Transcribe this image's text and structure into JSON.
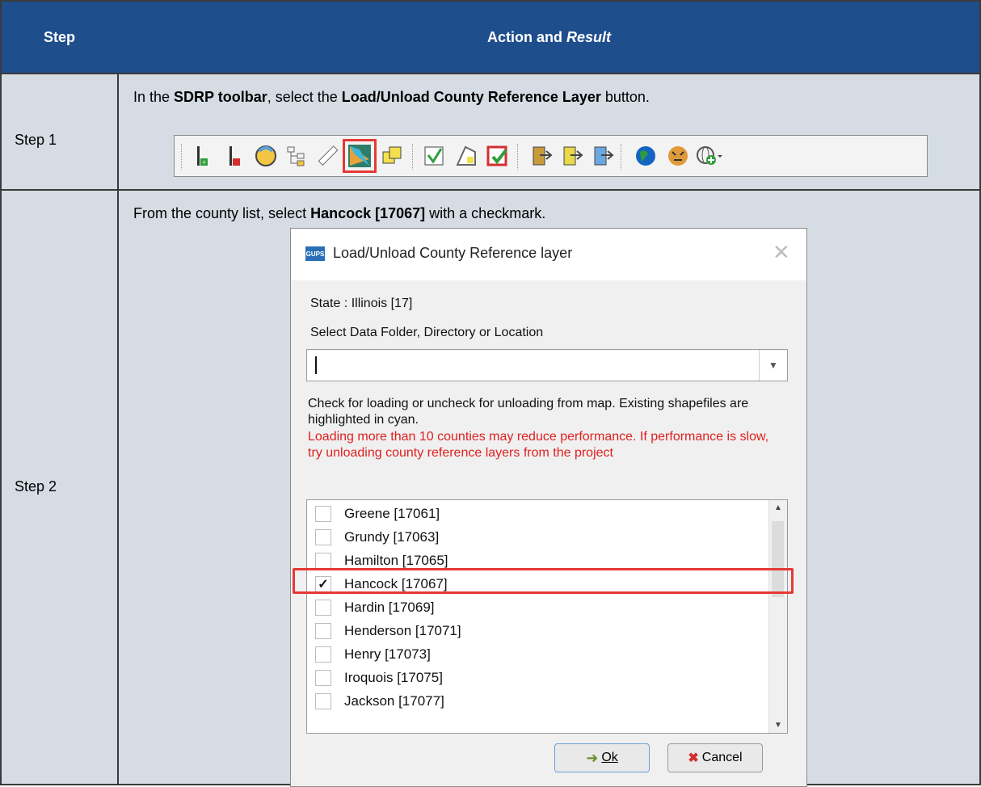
{
  "header": {
    "col_step": "Step",
    "col_action": "Action and ",
    "col_action_italic": "Result"
  },
  "step1": {
    "label": "Step 1",
    "text_a": "In the ",
    "bold_a": "SDRP toolbar",
    "text_b": ", select the ",
    "bold_b": "Load/Unload County Reference Layer",
    "text_c": " button.",
    "toolbar_icons": [
      "add-layer-icon",
      "remove-layer-icon",
      "face-icon",
      "structure-icon",
      "ruler-icon",
      "load-unload-county-icon",
      "copy-icon",
      "edit-icon",
      "shape-icon",
      "check-icon",
      "export-left-icon",
      "export-right-icon",
      "import-icon",
      "globe-icon",
      "tiger-icon",
      "web-add-icon"
    ]
  },
  "step2": {
    "label": "Step 2",
    "text_a": "From the county list, select ",
    "bold_a": "Hancock [17067]",
    "text_b": " with a checkmark."
  },
  "dialog": {
    "logo": "GUPS",
    "title": "Load/Unload County Reference layer",
    "state_label": "State : Illinois [17]",
    "folder_label": "Select Data Folder, Directory or Location",
    "combo_value": "",
    "info_text": "Check for loading or uncheck for unloading from map. Existing shapefiles are highlighted in cyan.",
    "warning_text": "Loading more than 10 counties may reduce performance. If performance is slow, try unloading county reference layers from the project",
    "counties": [
      {
        "name": "Greene [17061]",
        "checked": false
      },
      {
        "name": "Grundy [17063]",
        "checked": false
      },
      {
        "name": "Hamilton [17065]",
        "checked": false
      },
      {
        "name": "Hancock [17067]",
        "checked": true
      },
      {
        "name": "Hardin [17069]",
        "checked": false
      },
      {
        "name": "Henderson [17071]",
        "checked": false
      },
      {
        "name": "Henry [17073]",
        "checked": false
      },
      {
        "name": "Iroquois [17075]",
        "checked": false
      },
      {
        "name": "Jackson [17077]",
        "checked": false
      }
    ],
    "ok_label": "Ok",
    "cancel_label": "Cancel"
  },
  "colors": {
    "header_bg": "#1f4e8c",
    "row_bg": "#d5dce4",
    "highlight": "#e53935",
    "warning": "#e02020"
  }
}
